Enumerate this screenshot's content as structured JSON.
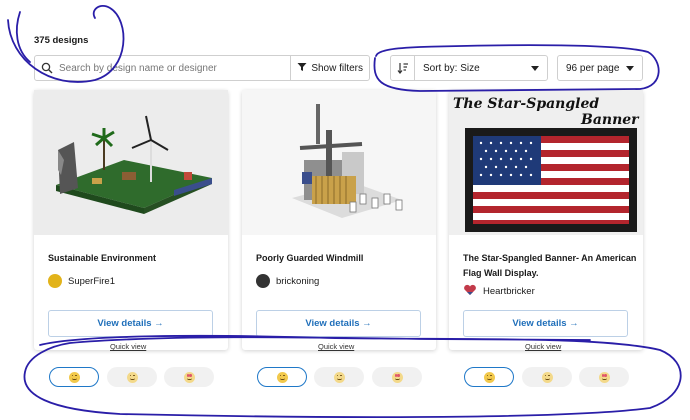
{
  "results": {
    "count_label": "375 designs"
  },
  "search": {
    "placeholder": "Search by design name or designer",
    "value": ""
  },
  "filters": {
    "label": "Show filters"
  },
  "sort": {
    "label": "Sort by: Size"
  },
  "per_page": {
    "label": "96 per page"
  },
  "cards": [
    {
      "title": "Sustainable Environment",
      "designer": "SuperFire1",
      "details_label": "View details →",
      "quick_view_label": "Quick view"
    },
    {
      "title": "Poorly Guarded Windmill",
      "designer": "brickoning",
      "details_label": "View details →",
      "quick_view_label": "Quick view"
    },
    {
      "title": "The Star-Spangled Banner- An American Flag Wall Display.",
      "designer": "Heartbricker",
      "details_label": "View details →",
      "quick_view_label": "Quick view",
      "image_caption_line1": "The Star-Spangled",
      "image_caption_line2": "Banner"
    }
  ],
  "colors": {
    "accent_blue": "#1f6fba",
    "annotation_ink": "#2a1ea8",
    "reaction_selected_border": "#1f78c8"
  }
}
